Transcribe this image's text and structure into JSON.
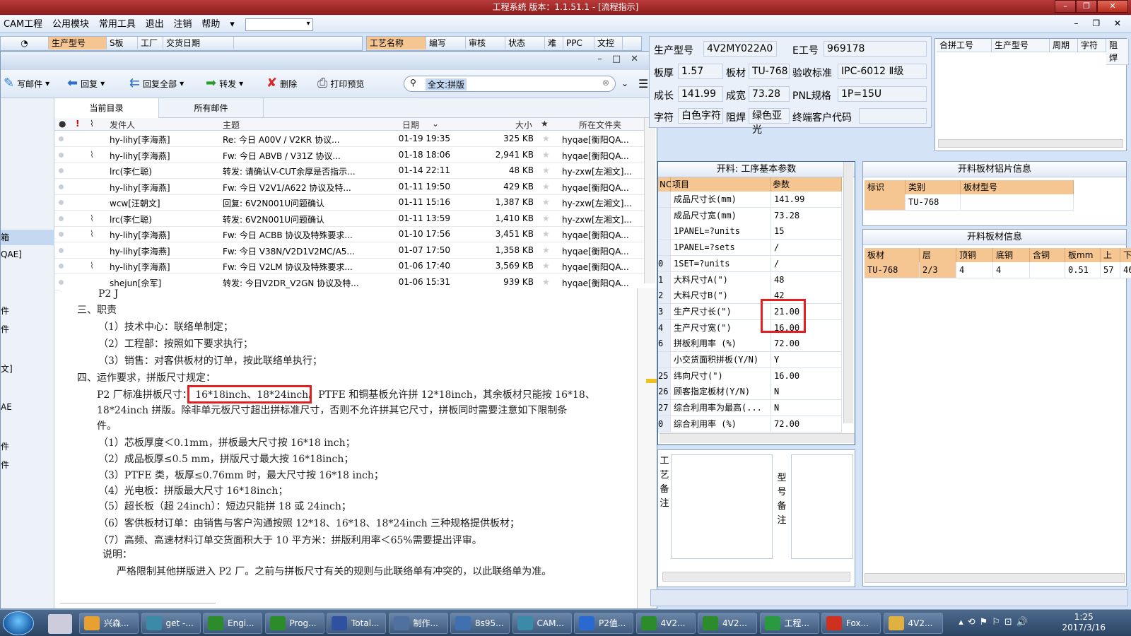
{
  "title_bar": {
    "text": "工程系统    版本：1.1.51.1 - [流程指示]"
  },
  "menu": {
    "items": [
      "CAM工程",
      "公用模块",
      "常用工具",
      "退出",
      "注销",
      "帮助"
    ]
  },
  "bg_headers": {
    "left": [
      "生产型号",
      "S板",
      "工厂",
      "交货日期"
    ],
    "mid": [
      "工艺名称",
      "编写",
      "审核",
      "状态",
      "难",
      "PPC",
      "文控"
    ]
  },
  "email": {
    "toolbar": {
      "compose": "写邮件",
      "reply": "回复",
      "reply_all": "回复全部",
      "forward": "转发",
      "delete": "删除",
      "print": "打印预览",
      "search": "全文:拼版"
    },
    "tabs": [
      "当前目录",
      "所有邮件"
    ],
    "columns": {
      "sender": "发件人",
      "subject": "主题",
      "date": "日期",
      "size": "大小",
      "folder": "所在文件夹"
    },
    "rows": [
      {
        "sender": "hy-lihy[李海燕]",
        "subject": "Re: 今日    A00V  /  V2KR   协议...",
        "date": "01-19 19:35",
        "size": "325 KB",
        "folder": "hyqae[衡阳QA...",
        "attach": false
      },
      {
        "sender": "hy-lihy[李海燕]",
        "subject": "Fw: 今日    ABVB  /  V31Z   协议...",
        "date": "01-18 18:06",
        "size": "2,941 KB",
        "folder": "hyqae[衡阳QA...",
        "attach": true
      },
      {
        "sender": "lrc(李仁聪)",
        "subject": "转发: 请确认V-CUT余厚是否指示...",
        "date": "01-14 22:11",
        "size": "48 KB",
        "folder": "hy-zxw[左湘文]...",
        "attach": false
      },
      {
        "sender": "hy-lihy[李海燕]",
        "subject": "Fw: 今日   V2V1/A622  协议及特...",
        "date": "01-11 19:50",
        "size": "429 KB",
        "folder": "hyqae[衡阳QA...",
        "attach": false
      },
      {
        "sender": "wcw[汪朝文]",
        "subject": "回复: 6V2N001U问题确认",
        "date": "01-11 15:16",
        "size": "1,387 KB",
        "folder": "hy-zxw[左湘文]...",
        "attach": false
      },
      {
        "sender": "lrc(李仁聪)",
        "subject": "转发: 6V2N001U问题确认",
        "date": "01-11 13:59",
        "size": "1,410 KB",
        "folder": "hy-zxw[左湘文]...",
        "attach": true
      },
      {
        "sender": "hy-lihy[李海燕]",
        "subject": "Fw: 今日   ACBB  协议及特殊要求...",
        "date": "01-10 17:56",
        "size": "3,451 KB",
        "folder": "hyqae[衡阳QA...",
        "attach": true
      },
      {
        "sender": "hy-lihy[李海燕]",
        "subject": "Fw: 今日   V38N/V2D1V2MC/A5...",
        "date": "01-07 17:50",
        "size": "1,358 KB",
        "folder": "hyqae[衡阳QA...",
        "attach": false
      },
      {
        "sender": "hy-lihy[李海燕]",
        "subject": "Fw: 今日    V2LM  协议及特殊要求...",
        "date": "01-06 17:40",
        "size": "3,569 KB",
        "folder": "hyqae[衡阳QA...",
        "attach": true
      },
      {
        "sender": "shejun[佘军]",
        "subject": "转发: 今日V2DR_V2GN  协议及特...",
        "date": "01-06 15:31",
        "size": "939 KB",
        "folder": "hyqae[衡阳QA...",
        "attach": false
      }
    ],
    "left_nav": [
      "箱",
      "QAE]",
      "件",
      "件",
      "文]",
      "AE",
      "件",
      "件"
    ],
    "doc": [
      "P2 J",
      "三、职责",
      "（1）技术中心：联络单制定；",
      "（2）工程部：按照如下要求执行；",
      "（3）销售：对客供板材的订单，按此联络单执行；",
      "四、运作要求，拼版尺寸规定：",
      "P2 厂标准拼板尺寸：  16*18inch、18*24inch。PTFE 和铜基板允许拼 12*18inch，其余板材只能按 16*18、",
      "18*24inch 拼版。除非单元板尺寸超出拼标准尺寸，否则不允许拼其它尺寸，拼板同时需要注意如下限制条",
      "件。",
      "（1）芯板厚度＜0.1mm，拼板最大尺寸按 16*18 inch；",
      "（2）成品板厚≤0.5 mm，拼版尺寸最大按 16*18inch；",
      "（3）PTFE 类，板厚≤0.76mm 时，最大尺寸按 16*18 inch；",
      "（4）光电板：拼版最大尺寸 16*18inch；",
      "（5）超长板（超 24inch）：短边只能拼 18 或 24inch；",
      "（6）客供板材订单：由销售与客户沟通按照 12*18、16*18、18*24inch 三种规格提供板材；",
      "（7）高频、高速材料订单交货面积大于 10 平方米：拼版利用率＜65%需要提出评审。",
      "说明：",
      "严格限制其他拼版进入 P2 厂。之前与拼板尺寸有关的规则与此联络单有冲突的，以此联络单为准。"
    ]
  },
  "info": {
    "prod_model_label": "生产型号",
    "prod_model": "4V2MY022A0",
    "e_no_label": "E工号",
    "e_no": "969178",
    "thick_label": "板厚",
    "thick": "1.57",
    "material_label": "板材",
    "material": "TU-768",
    "std_label": "验收标准",
    "std": "IPC-6012 Ⅱ级",
    "len_label": "成长",
    "len": "141.99",
    "wid_label": "成宽",
    "wid": "73.28",
    "pnl_label": "PNL规格",
    "pnl": "1P=15U",
    "char_label": "字符",
    "char": "白色字符",
    "mask_label": "阻焊",
    "mask": "绿色亚光",
    "cust_label": "终端客户代码",
    "cust": ""
  },
  "merge_table": {
    "headers": [
      "合拼工号",
      "生产型号",
      "周期",
      "字符",
      "阻焊"
    ]
  },
  "params": {
    "title": "开料: 工序基本参数",
    "headers": [
      "NO",
      "项目",
      "参数"
    ],
    "rows": [
      {
        "no": "",
        "item": "成品尺寸长(mm)",
        "val": "141.99"
      },
      {
        "no": "",
        "item": "成品尺寸宽(mm)",
        "val": "73.28"
      },
      {
        "no": "",
        "item": "1PANEL=?units",
        "val": "15"
      },
      {
        "no": "",
        "item": "1PANEL=?sets",
        "val": "/"
      },
      {
        "no": "0",
        "item": "1SET=?units",
        "val": "/"
      },
      {
        "no": "1",
        "item": "大料尺寸A(\")",
        "val": "48"
      },
      {
        "no": "2",
        "item": "大料尺寸B(\")",
        "val": "42"
      },
      {
        "no": "3",
        "item": "生产尺寸长(\")",
        "val": "21.00"
      },
      {
        "no": "4",
        "item": "生产尺寸宽(\")",
        "val": "16.00"
      },
      {
        "no": "6",
        "item": "拼板利用率 (%)",
        "val": "72.00"
      },
      {
        "no": "",
        "item": "小交货面积拼板(Y/N)",
        "val": "Y"
      },
      {
        "no": "25",
        "item": "纬向尺寸(\")",
        "val": "16.00"
      },
      {
        "no": "26",
        "item": "顾客指定板材(Y/N)",
        "val": "N"
      },
      {
        "no": "27",
        "item": "综合利用率为最高(...",
        "val": "N"
      },
      {
        "no": "0",
        "item": "综合利用率 (%)",
        "val": "72.00"
      }
    ]
  },
  "remarks": {
    "process": "工艺备注",
    "model": "型号备注"
  },
  "sheet_info": {
    "title": "开料板材铝片信息",
    "headers": [
      "标识",
      "类别",
      "板材型号"
    ],
    "row": [
      "",
      "TU-768",
      ""
    ]
  },
  "board_info": {
    "title": "开料板材信息",
    "headers": [
      "板材",
      "层",
      "顶铜",
      "底铜",
      "含铜mm",
      "板mm",
      "上",
      "下"
    ],
    "row": [
      "TU-768",
      "2/3",
      "4",
      "4",
      "",
      "0.51",
      "57",
      "46"
    ]
  },
  "taskbar": {
    "items": [
      "兴森...",
      "get -...",
      "Engi...",
      "Prog...",
      "Total...",
      "制作...",
      "8s95...",
      "CAM...",
      "P2值...",
      "4V2...",
      "4V2...",
      "工程...",
      "Fox...",
      "4V2..."
    ],
    "time": "1:25",
    "date": "2017/3/16"
  }
}
